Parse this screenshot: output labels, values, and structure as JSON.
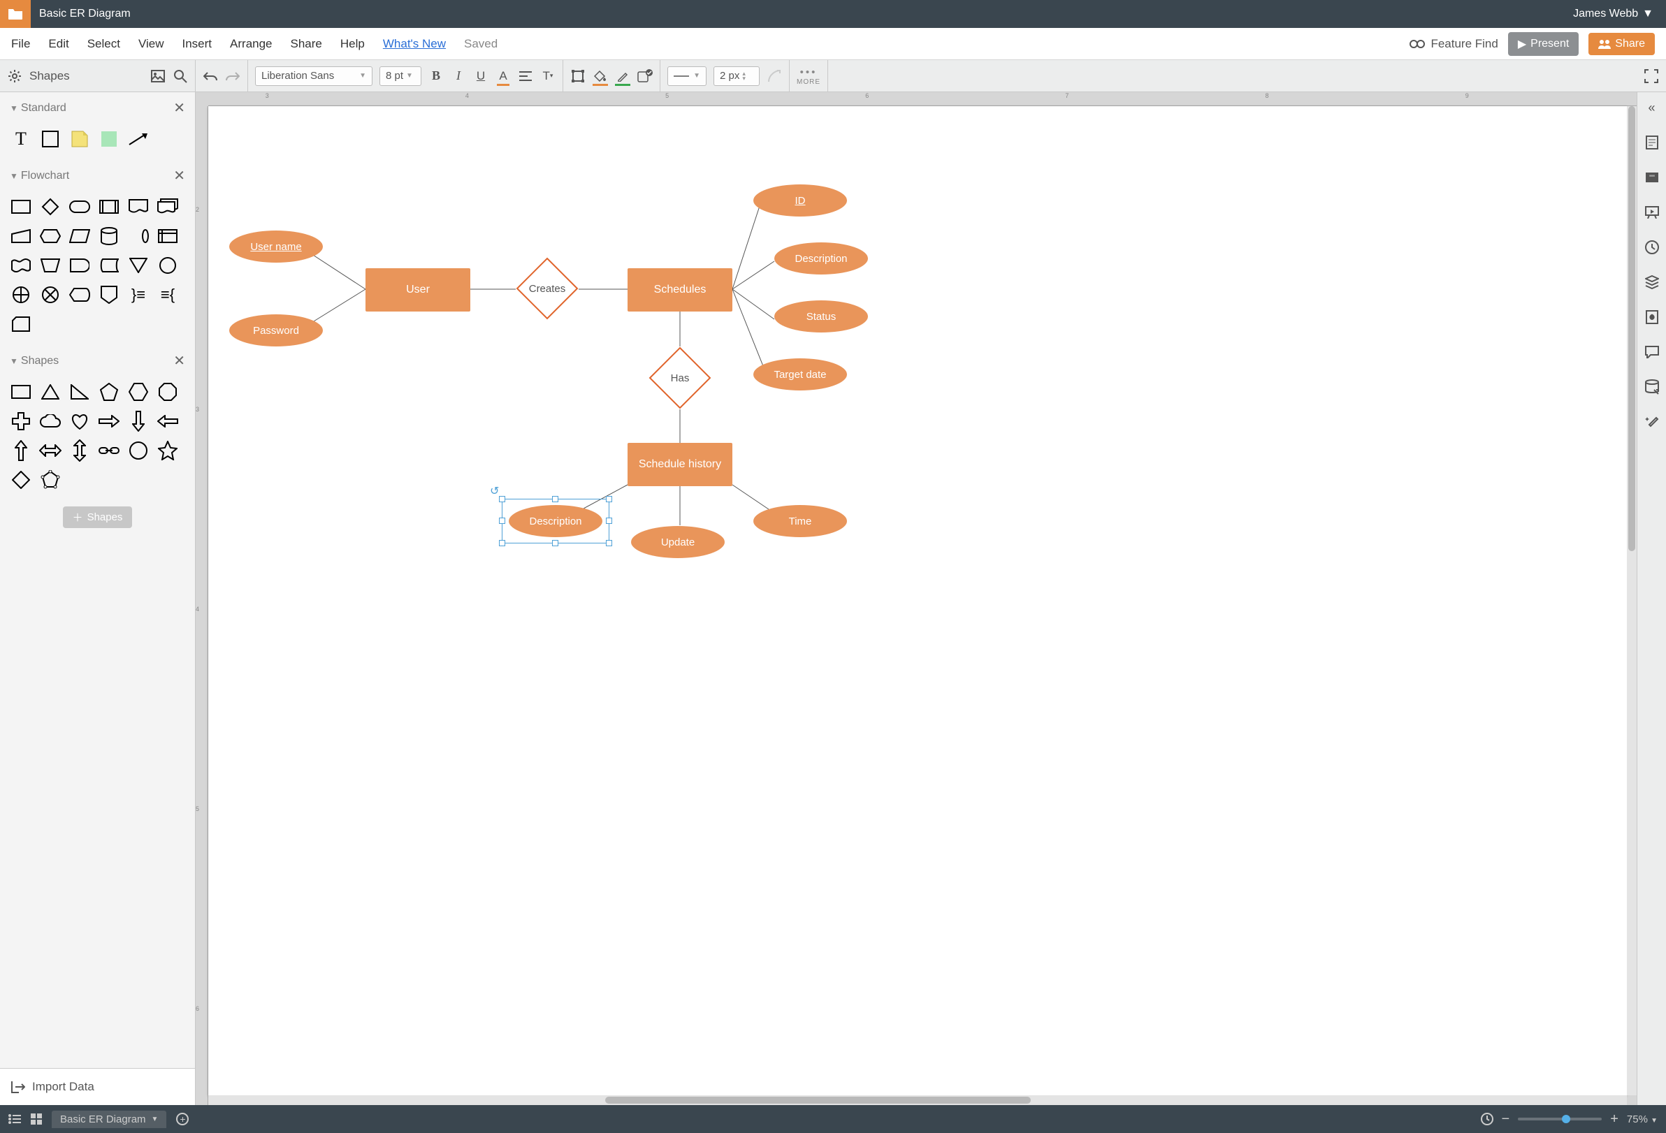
{
  "header": {
    "doc_title": "Basic ER Diagram",
    "user_name": "James Webb"
  },
  "menu": {
    "items": [
      "File",
      "Edit",
      "Select",
      "View",
      "Insert",
      "Arrange",
      "Share",
      "Help"
    ],
    "whats_new": "What's New",
    "saved": "Saved",
    "feature_find": "Feature Find",
    "present": "Present",
    "share": "Share"
  },
  "toolbar": {
    "shapes_label": "Shapes",
    "font": "Liberation Sans",
    "font_size": "8 pt",
    "line_width": "2 px",
    "more": "MORE"
  },
  "left_panel": {
    "groups": {
      "standard": "Standard",
      "flowchart": "Flowchart",
      "shapes": "Shapes"
    },
    "shapes_button": "Shapes",
    "import_data": "Import Data"
  },
  "ruler": {
    "h": [
      "3",
      "4",
      "5",
      "6",
      "7",
      "8",
      "9"
    ],
    "v": [
      "2",
      "3",
      "4",
      "5",
      "6"
    ]
  },
  "er": {
    "user_name": "User name",
    "password": "Password",
    "user": "User",
    "creates": "Creates",
    "schedules": "Schedules",
    "id": "ID",
    "description": "Description",
    "status": "Status",
    "target_date": "Target date",
    "has": "Has",
    "schedule_history": "Schedule history",
    "sh_description": "Description",
    "update": "Update",
    "time": "Time"
  },
  "right_icons": [
    "collapse",
    "note",
    "quote",
    "slides",
    "history",
    "layers",
    "fill",
    "comment",
    "data",
    "magic"
  ],
  "bottom": {
    "tab": "Basic ER Diagram",
    "zoom": "75%"
  }
}
